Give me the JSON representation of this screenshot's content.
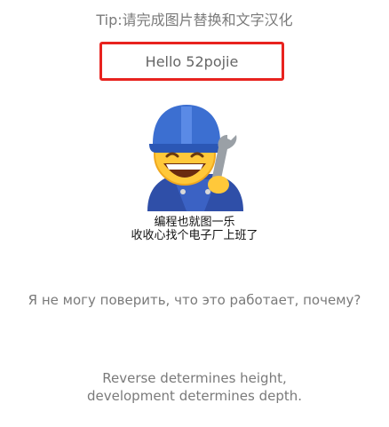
{
  "tip": "Tip:请完成图片替换和文字汉化",
  "hello_text": "Hello 52pojie",
  "image": {
    "caption_line1": "编程也就图一乐",
    "caption_line2": "收收心找个电子厂上班了"
  },
  "russian_text": "Я не могу поверить, что это работает, почему?",
  "quote": {
    "line1": "Reverse determines height,",
    "line2": "development determines depth."
  },
  "colors": {
    "highlight_border": "#e8231f",
    "gray_text": "#7a7a7a",
    "caption_text": "#111111"
  }
}
